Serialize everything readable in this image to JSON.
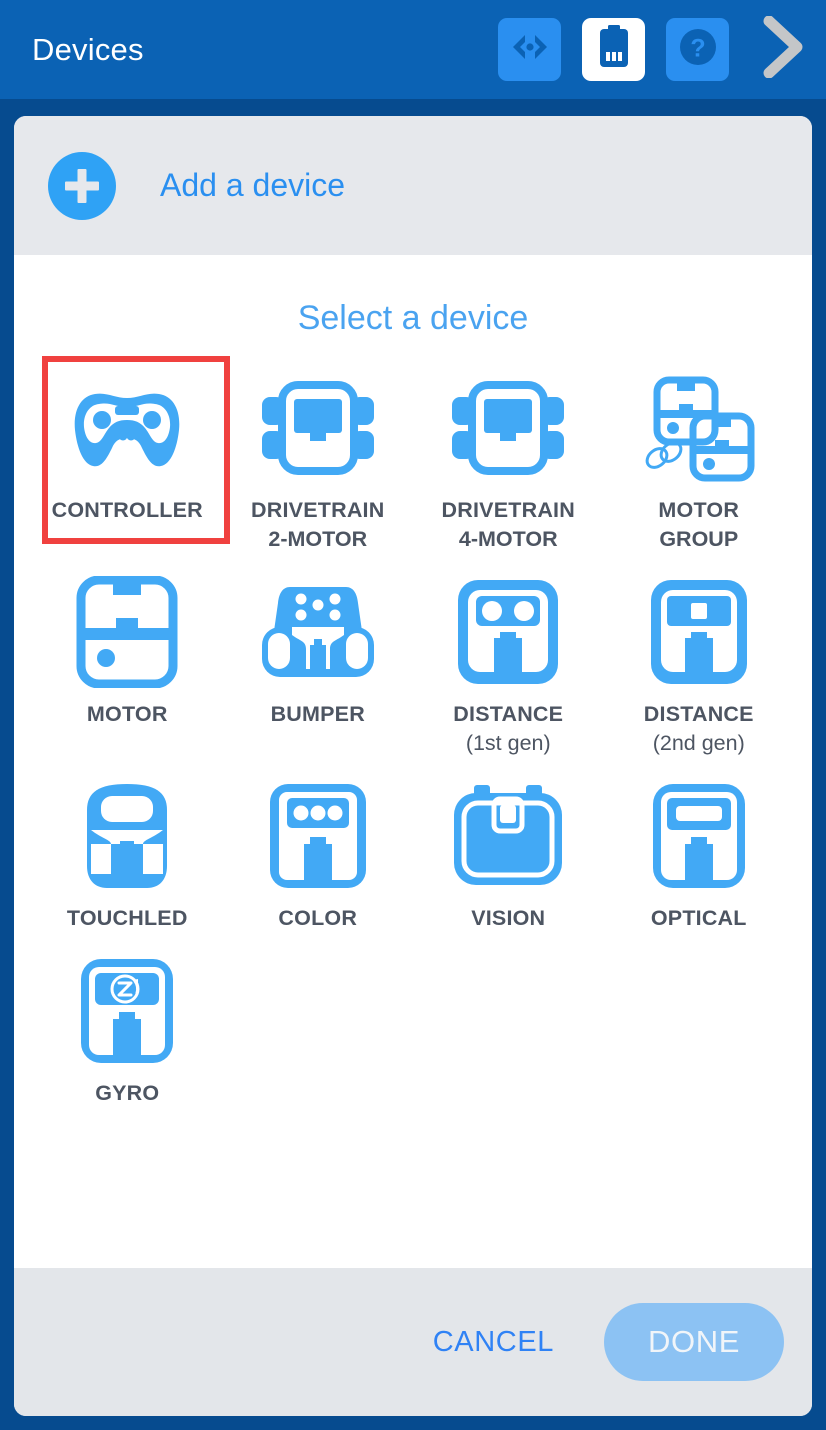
{
  "header": {
    "title": "Devices",
    "actions": [
      {
        "name": "code-view-button",
        "icon": "code-brackets-icon"
      },
      {
        "name": "battery-status-button",
        "icon": "battery-icon"
      },
      {
        "name": "help-button",
        "icon": "question-mark-icon"
      },
      {
        "name": "next-button",
        "icon": "chevron-right-icon"
      }
    ]
  },
  "add_bar": {
    "icon": "plus-icon",
    "label": "Add a device"
  },
  "dialog": {
    "title": "Select a device",
    "devices": [
      {
        "label": "CONTROLLER",
        "sub": "",
        "icon": "controller-icon",
        "selected": true
      },
      {
        "label": "DRIVETRAIN",
        "sub": "2-MOTOR",
        "icon": "drivetrain-2motor-icon",
        "selected": false
      },
      {
        "label": "DRIVETRAIN",
        "sub": "4-MOTOR",
        "icon": "drivetrain-4motor-icon",
        "selected": false
      },
      {
        "label": "MOTOR",
        "sub": "GROUP",
        "icon": "motor-group-icon",
        "selected": false
      },
      {
        "label": "MOTOR",
        "sub": "",
        "icon": "motor-icon",
        "selected": false
      },
      {
        "label": "BUMPER",
        "sub": "",
        "icon": "bumper-icon",
        "selected": false
      },
      {
        "label": "DISTANCE",
        "sub": "(1st gen)",
        "icon": "distance-1stgen-icon",
        "selected": false
      },
      {
        "label": "DISTANCE",
        "sub": "(2nd gen)",
        "icon": "distance-2ndgen-icon",
        "selected": false
      },
      {
        "label": "TOUCHLED",
        "sub": "",
        "icon": "touchled-icon",
        "selected": false
      },
      {
        "label": "COLOR",
        "sub": "",
        "icon": "color-sensor-icon",
        "selected": false
      },
      {
        "label": "VISION",
        "sub": "",
        "icon": "vision-sensor-icon",
        "selected": false
      },
      {
        "label": "OPTICAL",
        "sub": "",
        "icon": "optical-sensor-icon",
        "selected": false
      },
      {
        "label": "GYRO",
        "sub": "",
        "icon": "gyro-sensor-icon",
        "selected": false
      }
    ]
  },
  "footer": {
    "cancel_label": "CANCEL",
    "done_label": "DONE"
  },
  "colors": {
    "header_blue": "#0b62b4",
    "backdrop_blue": "#064b8f",
    "icon_blue": "#42a9f5",
    "accent_link": "#2a8ff0",
    "title_blue": "#4aa3f0",
    "selection_red": "#f0413f",
    "label_gray": "#4d5562",
    "panel_gray": "#e6e8ec",
    "done_blue": "#8cc2f3"
  }
}
